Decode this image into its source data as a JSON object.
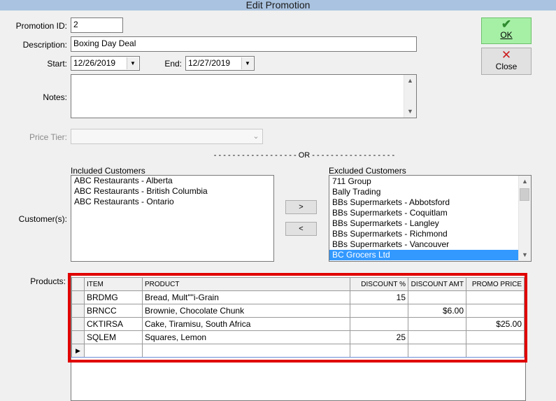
{
  "window": {
    "title": "Edit Promotion"
  },
  "form": {
    "promotion_id_label": "Promotion ID:",
    "promotion_id": "2",
    "description_label": "Description:",
    "description": "Boxing Day Deal",
    "start_label": "Start:",
    "start_date": "12/26/2019",
    "end_label": "End:",
    "end_date": "12/27/2019",
    "notes_label": "Notes:",
    "notes": "",
    "price_tier_label": "Price Tier:",
    "price_tier": "",
    "or_separator": "- - - - - - - - - - - - - - - - - - OR - - - - - - - - - - - - - - - - - -",
    "customers_label": "Customer(s):",
    "products_label": "Products:"
  },
  "buttons": {
    "ok_label": "OK",
    "close_label": "Close",
    "move_right_label": ">",
    "move_left_label": "<"
  },
  "icons": {
    "ok": "checkmark-icon",
    "close": "x-icon",
    "ok_color": "#2e8b2e",
    "close_color": "#cc1e1e"
  },
  "included_customers": {
    "label": "Included Customers",
    "items": [
      "ABC Restaurants - Alberta",
      "ABC Restaurants - British Columbia",
      "ABC Restaurants - Ontario"
    ]
  },
  "excluded_customers": {
    "label": "Excluded Customers",
    "items": [
      "711 Group",
      "Bally Trading",
      "BBs Supermarkets - Abbotsford",
      "BBs Supermarkets - Coquitlam",
      "BBs Supermarkets - Langley",
      "BBs Supermarkets - Richmond",
      "BBs Supermarkets - Vancouver",
      "BC Grocers Ltd"
    ],
    "selected": "BC Grocers Ltd"
  },
  "products": {
    "columns": [
      "ITEM",
      "PRODUCT",
      "DISCOUNT %",
      "DISCOUNT AMT",
      "PROMO PRICE"
    ],
    "rows": [
      [
        "BRDMG",
        "Bread, Mult\"\"i-Grain",
        "15",
        "",
        ""
      ],
      [
        "BRNCC",
        "Brownie, Chocolate Chunk",
        "",
        "$6.00",
        ""
      ],
      [
        "CKTIRSA",
        "Cake, Tiramisu, South Africa",
        "",
        "",
        "$25.00"
      ],
      [
        "SQLEM",
        "Squares, Lemon",
        "25",
        "",
        ""
      ]
    ],
    "new_row_marker": "▶"
  },
  "colors": {
    "highlight_border": "#e00000",
    "selection": "#3399ff",
    "titlebar": "#aac3e0"
  }
}
